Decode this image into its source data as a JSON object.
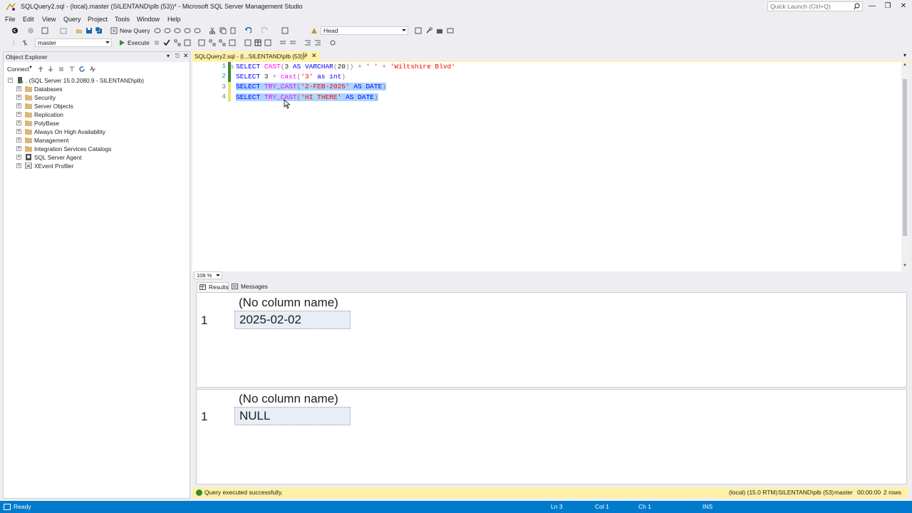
{
  "window": {
    "title": "SQLQuery2.sql - (local).master (SILENTAND\\plb (53))* - Microsoft SQL Server Management Studio",
    "quick_launch_placeholder": "Quick Launch (Ctrl+Q)"
  },
  "menu": [
    "File",
    "Edit",
    "View",
    "Query",
    "Project",
    "Tools",
    "Window",
    "Help"
  ],
  "toolbar": {
    "new_query_label": "New Query",
    "config_combo_value": "Head",
    "database_combo_value": "master",
    "execute_label": "Execute"
  },
  "object_explorer": {
    "title": "Object Explorer",
    "connect_label": "Connect",
    "server_node": ". (SQL Server 15.0.2080.9 - SILENTAND\\plb)",
    "nodes": [
      "Databases",
      "Security",
      "Server Objects",
      "Replication",
      "PolyBase",
      "Always On High Availability",
      "Management",
      "Integration Services Catalogs",
      "SQL Server Agent",
      "XEvent Profiler"
    ]
  },
  "editor": {
    "tab_title": "SQLQuery2.sql - (l...SILENTAND\\plb (53))*",
    "line_numbers": [
      "1",
      "2",
      "3",
      "4"
    ],
    "zoom": "108 %"
  },
  "results": {
    "tabs": [
      "Results",
      "Messages"
    ],
    "grids": [
      {
        "header": "(No column name)",
        "row_number": "1",
        "value": "2025-02-02"
      },
      {
        "header": "(No column name)",
        "row_number": "1",
        "value": "NULL"
      }
    ]
  },
  "query_status": {
    "message": "Query executed successfully.",
    "server": "(local) (15.0 RTM)",
    "login": "SILENTAND\\plb (53)",
    "database": "master",
    "elapsed": "00:00:00",
    "rows": "2 rows"
  },
  "status_bar": {
    "ready": "Ready",
    "ln": "Ln 3",
    "col": "Col 1",
    "ch": "Ch 1",
    "mode": "INS"
  },
  "colors": {
    "accent": "#007acc",
    "tab_active": "#fff1a8",
    "selection": "#add6ff",
    "keyword": "#0000ff",
    "function": "#ff00ff",
    "string": "#ff0000"
  }
}
